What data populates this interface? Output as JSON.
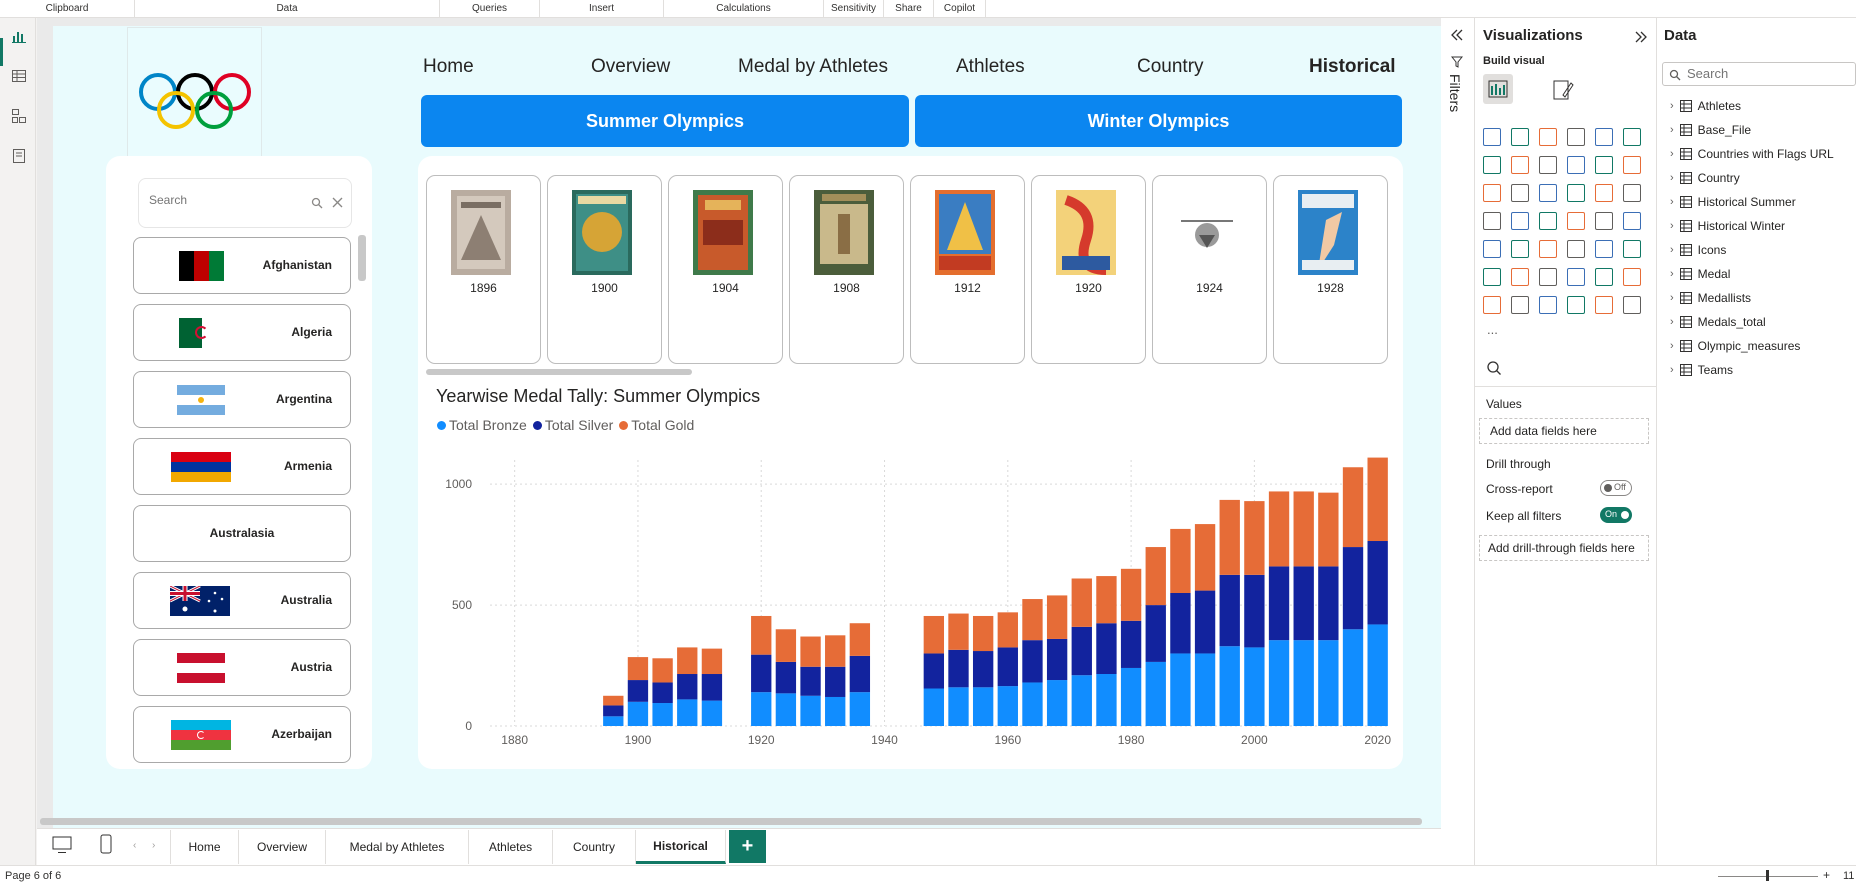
{
  "ribbon": {
    "groups": [
      "Clipboard",
      "Data",
      "Queries",
      "Insert",
      "Calculations",
      "Sensitivity",
      "Share",
      "Copilot"
    ]
  },
  "nav": {
    "tabs": [
      "Home",
      "Overview",
      "Medal by Athletes",
      "Athletes",
      "Country",
      "Historical"
    ],
    "active": "Historical"
  },
  "buttons": {
    "summer": "Summer Olympics",
    "winter": "Winter Olympics"
  },
  "slicer": {
    "search_placeholder": "Search",
    "countries": [
      "Afghanistan",
      "Algeria",
      "Argentina",
      "Armenia",
      "Australasia",
      "Australia",
      "Austria",
      "Azerbaijan"
    ]
  },
  "posters": {
    "years": [
      "1896",
      "1900",
      "1904",
      "1908",
      "1912",
      "1920",
      "1924",
      "1928"
    ]
  },
  "chart_data": {
    "type": "bar",
    "stacked": true,
    "title": "Yearwise Medal Tally: Summer Olympics",
    "legend_position": "top-left",
    "grid": true,
    "xlim": [
      1876,
      2022
    ],
    "ylim": [
      0,
      1100
    ],
    "xticks": [
      1880,
      1900,
      1920,
      1940,
      1960,
      1980,
      2000,
      2020
    ],
    "yticks": [
      0,
      500,
      1000
    ],
    "x": [
      1896,
      1900,
      1904,
      1908,
      1912,
      1920,
      1924,
      1928,
      1932,
      1936,
      1948,
      1952,
      1956,
      1960,
      1964,
      1968,
      1972,
      1976,
      1980,
      1984,
      1988,
      1992,
      1996,
      2000,
      2004,
      2008,
      2012,
      2016,
      2020
    ],
    "series": [
      {
        "name": "Total Bronze",
        "color": "#118DFF",
        "values": [
          40,
          100,
          95,
          110,
          105,
          140,
          135,
          125,
          120,
          140,
          155,
          160,
          160,
          165,
          180,
          190,
          210,
          215,
          240,
          265,
          300,
          300,
          330,
          325,
          355,
          355,
          355,
          400,
          420
        ]
      },
      {
        "name": "Total Silver",
        "color": "#12239E",
        "values": [
          45,
          90,
          85,
          105,
          110,
          155,
          130,
          120,
          125,
          150,
          145,
          155,
          150,
          160,
          175,
          170,
          200,
          210,
          195,
          235,
          250,
          260,
          295,
          300,
          305,
          305,
          305,
          340,
          345
        ]
      },
      {
        "name": "Total Gold",
        "color": "#E66C37",
        "values": [
          40,
          95,
          100,
          110,
          105,
          160,
          135,
          125,
          130,
          135,
          155,
          150,
          145,
          145,
          170,
          180,
          200,
          195,
          215,
          240,
          265,
          275,
          310,
          305,
          310,
          310,
          305,
          330,
          345
        ]
      }
    ]
  },
  "filters": {
    "label": "Filters"
  },
  "viz": {
    "title": "Visualizations",
    "build_label": "Build visual",
    "more": "...",
    "values_label": "Values",
    "values_placeholder": "Add data fields here",
    "drill_label": "Drill through",
    "cross_report": "Cross-report",
    "cross_state": "Off",
    "keep_filters": "Keep all filters",
    "keep_state": "On",
    "drill_placeholder": "Add drill-through fields here"
  },
  "data_pane": {
    "title": "Data",
    "search_placeholder": "Search",
    "tables": [
      "Athletes",
      "Base_File",
      "Countries with Flags URL",
      "Country",
      "Historical Summer",
      "Historical Winter",
      "Icons",
      "Medal",
      "Medallists",
      "Medals_total",
      "Olympic_measures",
      "Teams"
    ]
  },
  "page_tabs": {
    "tabs": [
      "Home",
      "Overview",
      "Medal by Athletes",
      "Athletes",
      "Country",
      "Historical"
    ],
    "active": "Historical",
    "add": "+"
  },
  "status": {
    "page": "Page 6 of 6",
    "zoom": "11"
  }
}
